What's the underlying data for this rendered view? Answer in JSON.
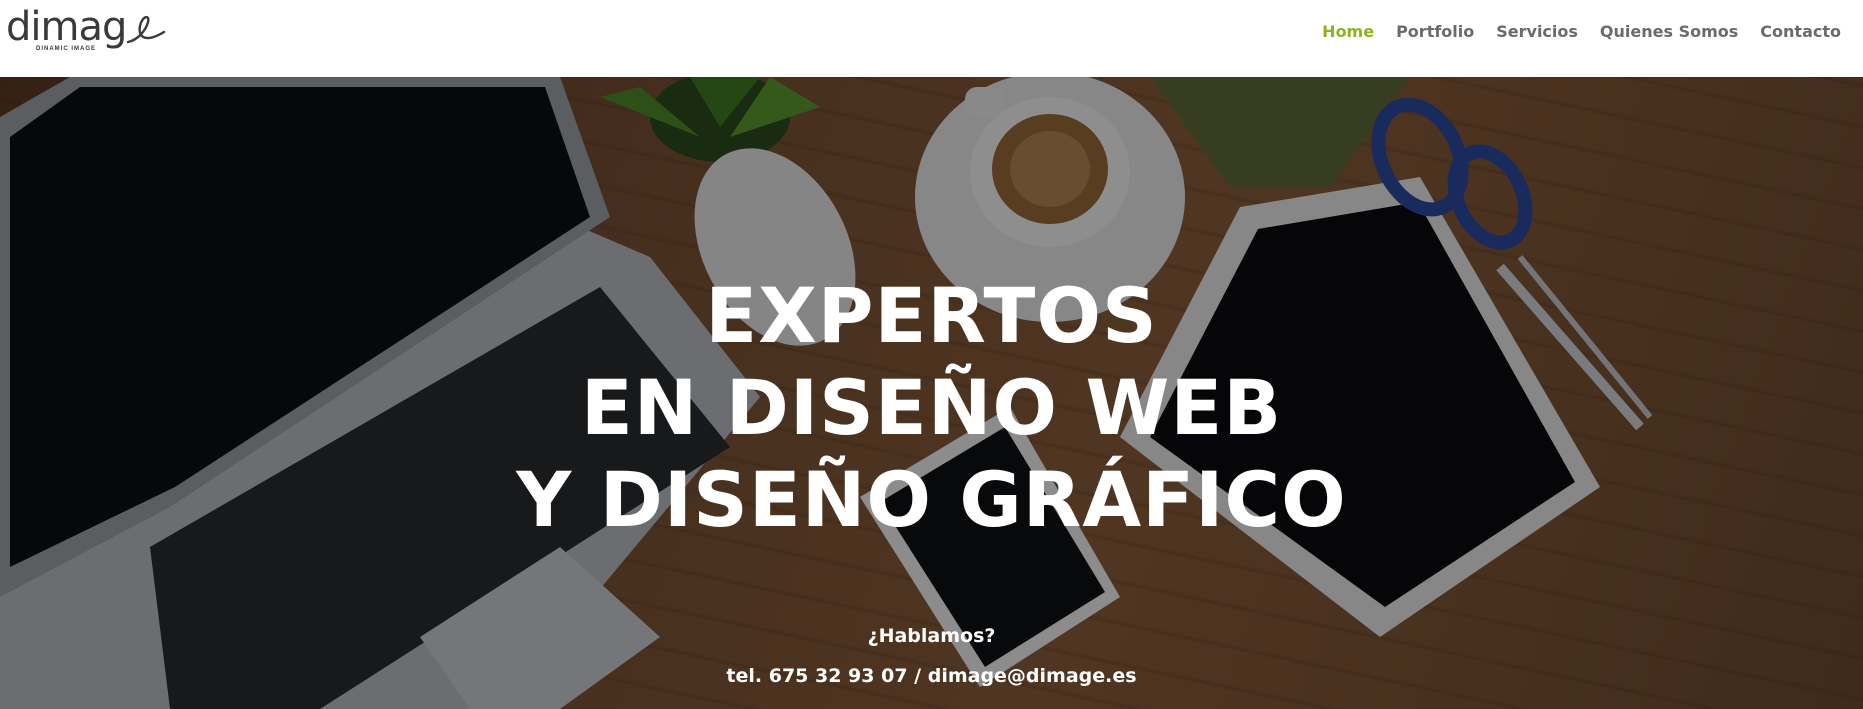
{
  "brand": {
    "logo_word": "dimag",
    "logo_sub": "DINAMIC IMAGE"
  },
  "nav": {
    "items": [
      {
        "label": "Home",
        "active": true
      },
      {
        "label": "Portfolio",
        "active": false
      },
      {
        "label": "Servicios",
        "active": false
      },
      {
        "label": "Quienes Somos",
        "active": false
      },
      {
        "label": "Contacto",
        "active": false
      }
    ]
  },
  "hero": {
    "line1": "EXPERTOS",
    "line2": "EN DISEÑO WEB",
    "line3": "Y DISEÑO GRÁFICO",
    "question": "¿Hablamos?",
    "contact": "tel. 675 32 93 07 / dimage@dimage.es"
  },
  "colors": {
    "accent": "#8fb220",
    "nav_text": "#6b6b6b",
    "hero_text": "#ffffff"
  }
}
